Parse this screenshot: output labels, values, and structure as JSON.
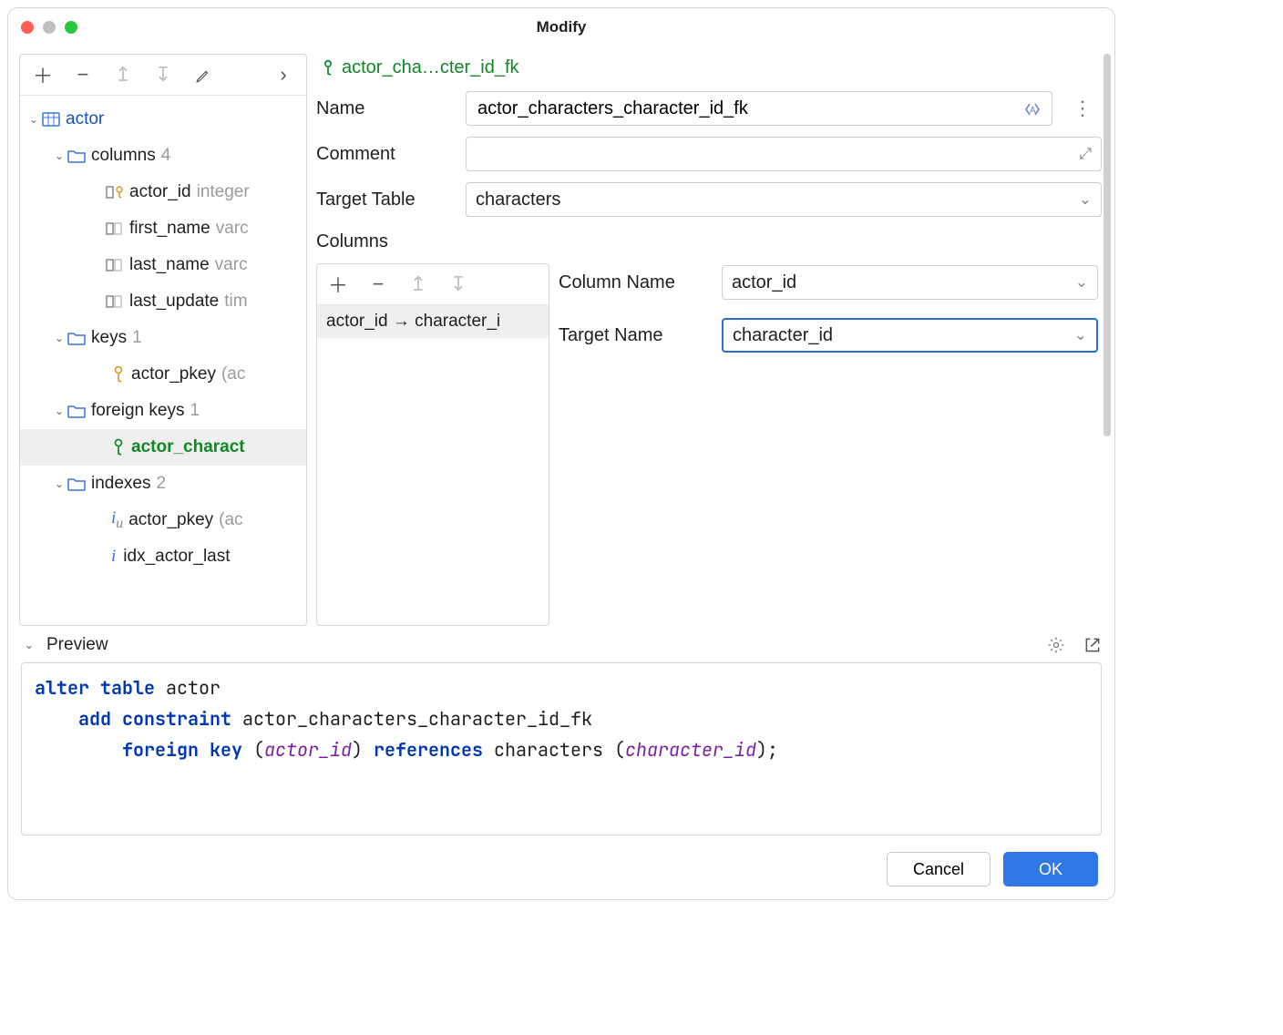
{
  "window": {
    "title": "Modify"
  },
  "left_toolbar": {},
  "tree": {
    "table_name": "actor",
    "groups": {
      "columns": {
        "label": "columns",
        "count": "4",
        "items": [
          {
            "name": "actor_id",
            "type": "integer"
          },
          {
            "name": "first_name",
            "type": "varchar"
          },
          {
            "name": "last_name",
            "type": "varchar"
          },
          {
            "name": "last_update",
            "type": "timestamp"
          }
        ]
      },
      "keys": {
        "label": "keys",
        "count": "1",
        "items": [
          {
            "name": "actor_pkey",
            "note": "(ac"
          }
        ]
      },
      "foreign_keys": {
        "label": "foreign keys",
        "count": "1",
        "items": [
          {
            "name": "actor_characters_character_id_fk",
            "display": "actor_charact"
          }
        ]
      },
      "indexes": {
        "label": "indexes",
        "count": "2",
        "items": [
          {
            "name": "actor_pkey",
            "note": "(ac"
          },
          {
            "name": "idx_actor_last",
            "display": "idx_actor_last"
          }
        ]
      }
    }
  },
  "breadcrumb": "actor_cha…cter_id_fk",
  "form": {
    "name_label": "Name",
    "name_value": "actor_characters_character_id_fk",
    "comment_label": "Comment",
    "comment_value": "",
    "target_table_label": "Target Table",
    "target_table_value": "characters",
    "columns_label": "Columns",
    "column_mapping": "actor_id → character_i",
    "column_name_label": "Column Name",
    "column_name_value": "actor_id",
    "target_name_label": "Target Name",
    "target_name_value": "character_id"
  },
  "preview": {
    "label": "Preview",
    "sql": {
      "l1a": "alter",
      "l1b": "table",
      "l1c": "actor",
      "l2a": "add",
      "l2b": "constraint",
      "l2c": "actor_characters_character_id_fk",
      "l3a": "foreign",
      "l3b": "key",
      "l3c": "(",
      "l3d": "actor_id",
      "l3e": ")",
      "l3f": "references",
      "l3g": "characters (",
      "l3h": "character_id",
      "l3i": ");"
    }
  },
  "buttons": {
    "cancel": "Cancel",
    "ok": "OK"
  }
}
